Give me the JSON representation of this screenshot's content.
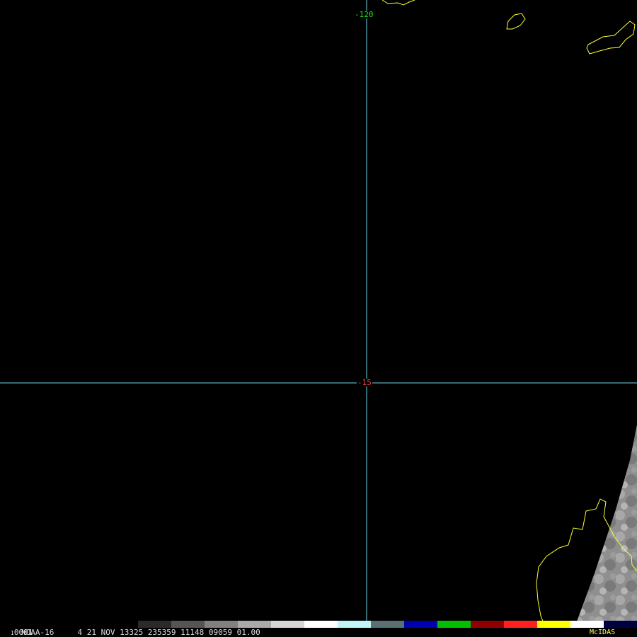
{
  "grid": {
    "longitude_label": "-120",
    "latitude_label": "-15",
    "line_color": "#6fd3e6",
    "longitude_label_color": "#22dd22",
    "latitude_label_color": "#ff3b3b"
  },
  "coastline_color": "#ffff33",
  "status": {
    "frame": "0001",
    "text": "NOAA-16     4 21 NOV 13325 235359 11148 09059 01.00",
    "logo": "McIDAS",
    "text_color": "#dddddd",
    "logo_color": "#ffff66"
  },
  "colorbar": {
    "stops": [
      "#000000",
      "#2a2a2a",
      "#555555",
      "#808080",
      "#aaaaaa",
      "#d5d5d5",
      "#ffffff",
      "#bff5f5",
      "#5a7070",
      "#0000b0",
      "#00c000",
      "#900000",
      "#ff2020",
      "#ffff00",
      "#ffffff",
      "#000040"
    ]
  }
}
